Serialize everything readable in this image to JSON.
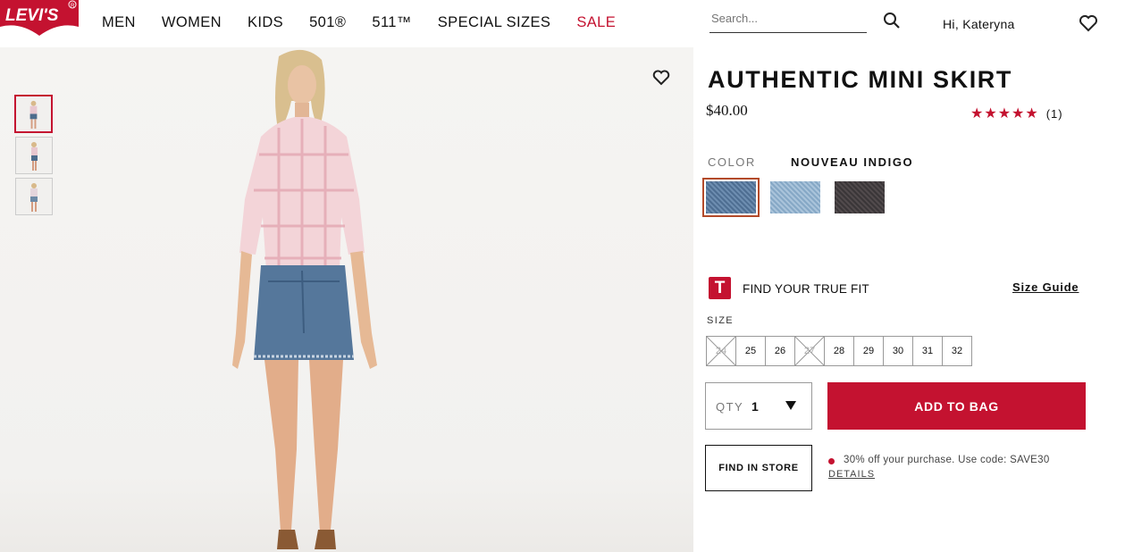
{
  "brand": {
    "logo_text": "LEVI'S",
    "accent_color": "#c41230"
  },
  "nav": {
    "items": [
      {
        "label": "MEN"
      },
      {
        "label": "WOMEN"
      },
      {
        "label": "KIDS"
      },
      {
        "label": "501®"
      },
      {
        "label": "511™"
      },
      {
        "label": "SPECIAL SIZES"
      },
      {
        "label": "SALE"
      }
    ]
  },
  "search": {
    "placeholder": "Search..."
  },
  "user": {
    "greeting": "Hi, Kateryna"
  },
  "icons": {
    "search": "search-icon",
    "wishlist": "heart-icon",
    "true_fit": "T"
  },
  "gallery": {
    "thumbnails": 3,
    "active_index": 0
  },
  "product": {
    "title": "AUTHENTIC MINI SKIRT",
    "price": "$40.00",
    "rating_stars": "★★★★★",
    "rating": 5,
    "review_count": "(1)"
  },
  "color": {
    "label": "COLOR",
    "selected_name": "NOUVEAU INDIGO",
    "swatches": [
      {
        "name": "nouveau indigo",
        "color": "#5a7896",
        "selected": true
      },
      {
        "name": "light wash",
        "color": "#93b2cc",
        "selected": false
      },
      {
        "name": "black",
        "color": "#3f3a3c",
        "selected": false
      }
    ]
  },
  "true_fit": {
    "icon_letter": "T",
    "label": "FIND YOUR TRUE FIT",
    "size_guide": "Size Guide"
  },
  "sizes": {
    "label": "SIZE",
    "options": [
      {
        "label": "24",
        "available": false
      },
      {
        "label": "25",
        "available": true
      },
      {
        "label": "26",
        "available": true
      },
      {
        "label": "27",
        "available": false
      },
      {
        "label": "28",
        "available": true
      },
      {
        "label": "29",
        "available": true
      },
      {
        "label": "30",
        "available": true
      },
      {
        "label": "31",
        "available": true
      },
      {
        "label": "32",
        "available": true
      }
    ]
  },
  "qty": {
    "label": "QTY",
    "value": "1"
  },
  "actions": {
    "add_to_bag": "ADD TO BAG",
    "find_in_store": "FIND IN STORE"
  },
  "promo": {
    "text": "30% off your purchase. Use code: SAVE30",
    "details": "DETAILS"
  }
}
